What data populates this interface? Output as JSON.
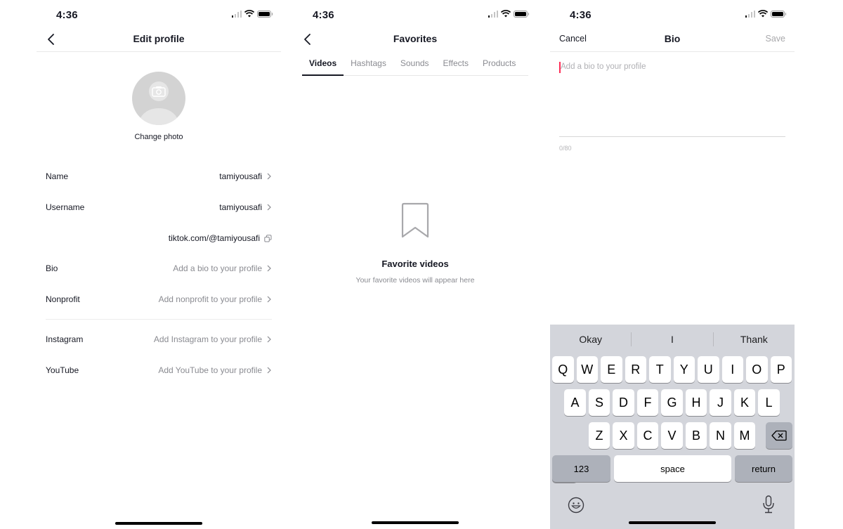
{
  "status_bar": {
    "time": "4:36"
  },
  "edit_profile": {
    "title": "Edit profile",
    "change_photo": "Change photo",
    "rows": [
      {
        "label": "Name",
        "value": "tamiyousafi",
        "placeholder": false
      },
      {
        "label": "Username",
        "value": "tamiyousafi",
        "placeholder": false
      },
      {
        "label": "",
        "value": "tiktok.com/@tamiyousafi",
        "placeholder": false
      },
      {
        "label": "Bio",
        "value": "Add a bio to your profile",
        "placeholder": true
      },
      {
        "label": "Nonprofit",
        "value": "Add nonprofit to your profile",
        "placeholder": true
      },
      {
        "label": "Instagram",
        "value": "Add Instagram to your profile",
        "placeholder": true
      },
      {
        "label": "YouTube",
        "value": "Add YouTube to your profile",
        "placeholder": true
      }
    ]
  },
  "favorites": {
    "title": "Favorites",
    "tabs": [
      "Videos",
      "Hashtags",
      "Sounds",
      "Effects",
      "Products"
    ],
    "active_tab": "Videos",
    "empty_title": "Favorite videos",
    "empty_subtitle": "Your favorite videos will appear here"
  },
  "bio_editor": {
    "title": "Bio",
    "cancel_label": "Cancel",
    "save_label": "Save",
    "placeholder": "Add a bio to your profile",
    "value": "",
    "counter": "0/80",
    "caret_color": "#fe2c55"
  },
  "keyboard": {
    "suggestions": [
      "Okay",
      "I",
      "Thank"
    ],
    "row1": [
      "Q",
      "W",
      "E",
      "R",
      "T",
      "Y",
      "U",
      "I",
      "O",
      "P"
    ],
    "row2": [
      "A",
      "S",
      "D",
      "F",
      "G",
      "H",
      "J",
      "K",
      "L"
    ],
    "row3": [
      "Z",
      "X",
      "C",
      "V",
      "B",
      "N",
      "M"
    ],
    "numbers_label": "123",
    "space_label": "space",
    "return_label": "return"
  }
}
